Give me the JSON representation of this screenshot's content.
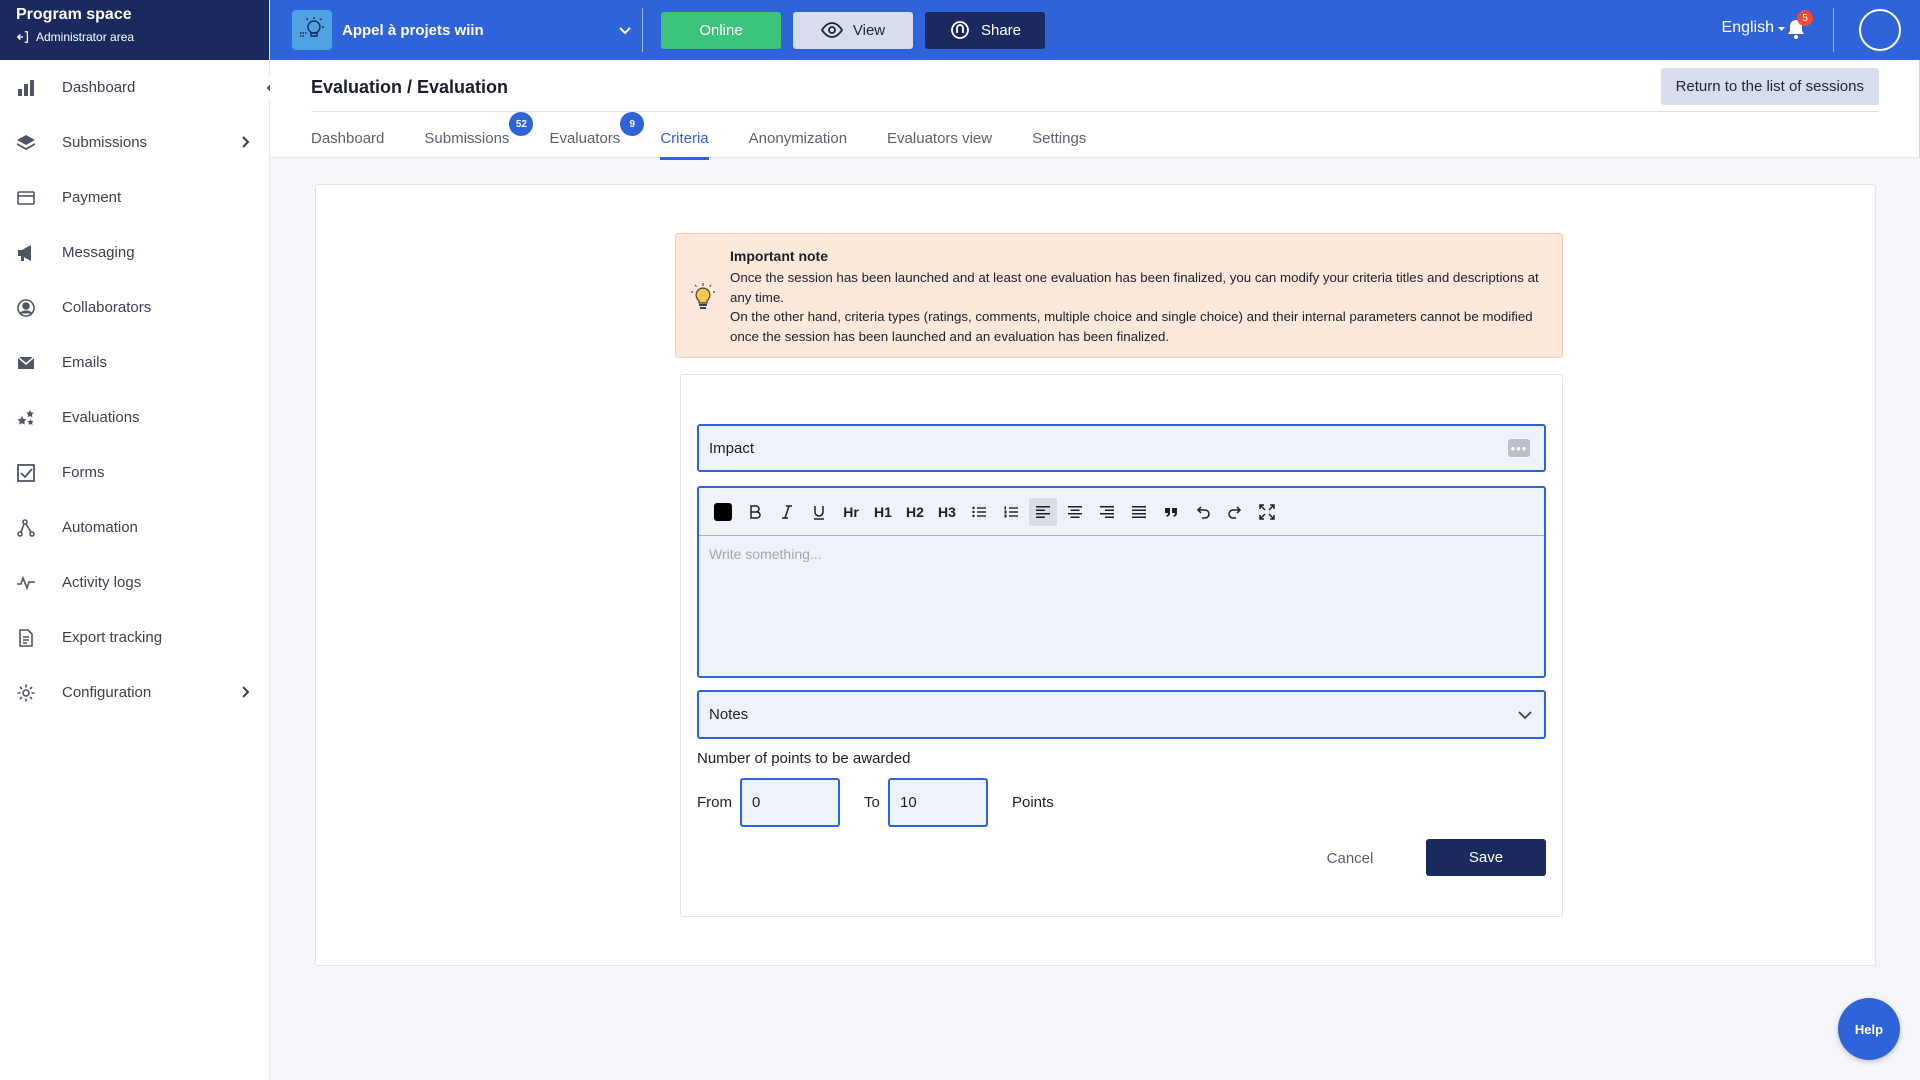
{
  "sidebar": {
    "title": "Program space",
    "subtitle": "Administrator area",
    "items": [
      {
        "label": "Dashboard",
        "icon": "bar-chart-icon"
      },
      {
        "label": "Submissions",
        "icon": "layers-icon",
        "has_chevron": true
      },
      {
        "label": "Payment",
        "icon": "credit-card-icon"
      },
      {
        "label": "Messaging",
        "icon": "megaphone-icon"
      },
      {
        "label": "Collaborators",
        "icon": "user-circle-icon"
      },
      {
        "label": "Emails",
        "icon": "envelope-icon"
      },
      {
        "label": "Evaluations",
        "icon": "stars-icon"
      },
      {
        "label": "Forms",
        "icon": "checkbox-icon"
      },
      {
        "label": "Automation",
        "icon": "automation-icon"
      },
      {
        "label": "Activity logs",
        "icon": "pulse-icon"
      },
      {
        "label": "Export tracking",
        "icon": "document-icon"
      },
      {
        "label": "Configuration",
        "icon": "gear-icon",
        "has_chevron": true
      }
    ]
  },
  "topbar": {
    "project_name": "Appel à projets wiin",
    "online_label": "Online",
    "view_label": "View",
    "share_label": "Share",
    "language": "English",
    "notification_count": "5",
    "accent_color": "#2f63d9",
    "online_color": "#3cc57a",
    "dark_color": "#1b2a5e"
  },
  "header": {
    "title": "Evaluation / Evaluation",
    "return_label": "Return to the list of sessions",
    "tabs": [
      {
        "label": "Dashboard"
      },
      {
        "label": "Submissions",
        "badge": "52"
      },
      {
        "label": "Evaluators",
        "badge": "9"
      },
      {
        "label": "Criteria",
        "active": true
      },
      {
        "label": "Anonymization"
      },
      {
        "label": "Evaluators view"
      },
      {
        "label": "Settings"
      }
    ]
  },
  "note": {
    "title": "Important note",
    "line1": "Once the session has been launched and at least one evaluation has been finalized, you can modify your criteria titles and descriptions at any time.",
    "line2": "On the other hand, criteria types (ratings, comments, multiple choice and single choice) and their internal parameters cannot be modified once the session has been launched and an evaluation has been finalized."
  },
  "form": {
    "criteria_title": "Impact",
    "editor_placeholder": "Write something...",
    "toolbar": [
      "text-color",
      "B",
      "I",
      "U",
      "Hr",
      "H1",
      "H2",
      "H3",
      "bullet-list",
      "numbered-list",
      "align-left",
      "align-center",
      "align-right",
      "align-justify",
      "quote",
      "undo",
      "redo",
      "fullscreen"
    ],
    "type_select": "Notes",
    "points_label": "Number of points to be awarded",
    "from_label": "From",
    "from_value": "0",
    "to_label": "To",
    "to_value": "10",
    "points_unit": "Points",
    "cancel_label": "Cancel",
    "save_label": "Save"
  },
  "help_label": "Help"
}
